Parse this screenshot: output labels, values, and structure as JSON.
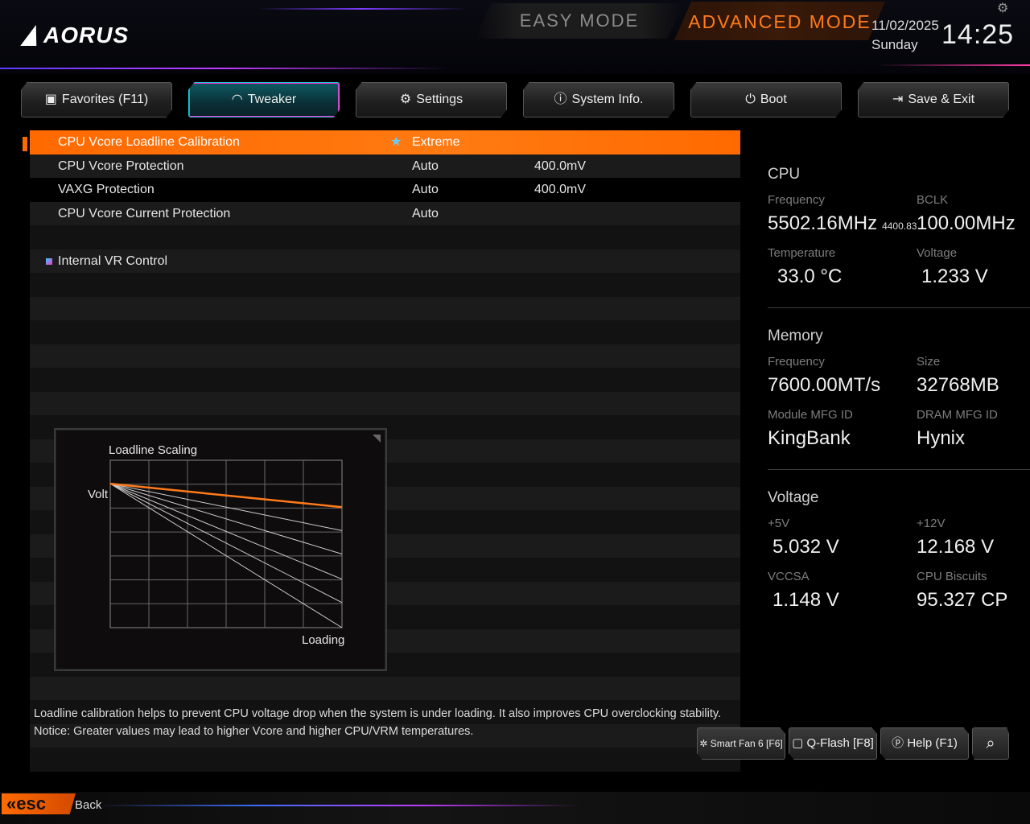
{
  "brand": {
    "logo_text": "AORUS"
  },
  "modes": {
    "easy": "EASY MODE",
    "advanced": "ADVANCED MODE"
  },
  "clock": {
    "date": "11/02/2025",
    "weekday": "Sunday",
    "time": "14:25"
  },
  "tabs": [
    {
      "label": "Favorites (F11)",
      "icon": "favorites-icon"
    },
    {
      "label": "Tweaker",
      "icon": "speedometer-icon",
      "active": true
    },
    {
      "label": "Settings",
      "icon": "gear-icon"
    },
    {
      "label": "System Info.",
      "icon": "info-icon"
    },
    {
      "label": "Boot",
      "icon": "power-icon"
    },
    {
      "label": "Save & Exit",
      "icon": "exit-icon"
    }
  ],
  "settings": [
    {
      "label": "CPU Vcore Loadline Calibration",
      "value": "Extreme",
      "selected": true
    },
    {
      "label": "CPU Vcore Protection",
      "value": "Auto",
      "value2": "400.0mV"
    },
    {
      "label": "VAXG Protection",
      "value": "Auto",
      "value2": "400.0mV"
    },
    {
      "label": "CPU Vcore Current Protection",
      "value": "Auto"
    },
    {
      "label": ""
    },
    {
      "label": "Internal VR Control",
      "submenu": true
    }
  ],
  "chart": {
    "title": "Loadline Scaling",
    "ylabel": "Volt",
    "xlabel": "Loading",
    "selected_color": "#ff7a1a",
    "line_color": "#cfcfcf"
  },
  "chart_data": {
    "type": "line",
    "title": "Loadline Scaling",
    "xlabel": "Loading",
    "ylabel": "Volt",
    "x": [
      0,
      1
    ],
    "xlim": [
      0,
      1
    ],
    "ylim": [
      0,
      1
    ],
    "grid": true,
    "series": [
      {
        "values": [
          0.86,
          0.72
        ],
        "highlight": true
      },
      {
        "values": [
          0.86,
          0.58
        ]
      },
      {
        "values": [
          0.86,
          0.44
        ]
      },
      {
        "values": [
          0.86,
          0.29
        ]
      },
      {
        "values": [
          0.86,
          0.15
        ]
      },
      {
        "values": [
          0.86,
          0.0
        ]
      }
    ]
  },
  "info": {
    "cpu": {
      "title": "CPU",
      "frequency_label": "Frequency",
      "frequency": "5502.16MHz",
      "frequency_sub": "4400.83",
      "bclk_label": "BCLK",
      "bclk": "100.00MHz",
      "temp_label": "Temperature",
      "temp": "33.0 °C",
      "voltage_label": "Voltage",
      "voltage": "1.233 V"
    },
    "memory": {
      "title": "Memory",
      "frequency_label": "Frequency",
      "frequency": "7600.00MT/s",
      "size_label": "Size",
      "size": "32768MB",
      "module_label": "Module MFG ID",
      "module": "KingBank",
      "dram_label": "DRAM MFG ID",
      "dram": "Hynix"
    },
    "voltage": {
      "title": "Voltage",
      "v5_label": "+5V",
      "v5": "5.032 V",
      "v12_label": "+12V",
      "v12": "12.168 V",
      "vccsa_label": "VCCSA",
      "vccsa": "1.148 V",
      "biscuits_label": "CPU Biscuits",
      "biscuits": "95.327 CP"
    }
  },
  "help": {
    "line1": "Loadline calibration helps to prevent CPU voltage drop when the system is under loading. It also improves CPU overclocking stability.",
    "line2": "Notice: Greater values may lead to higher Vcore and higher CPU/VRM temperatures."
  },
  "bottom_buttons": [
    {
      "label": "Smart Fan 6 [F6]",
      "icon": "fan-icon"
    },
    {
      "label": "Q-Flash [F8]",
      "icon": "chip-icon"
    },
    {
      "label": "Help (F1)",
      "icon": "help-icon"
    }
  ],
  "esc": {
    "key": "esc",
    "label": "Back"
  },
  "colors": {
    "accent": "#ff6a00",
    "tab_active": "#1fc8d8",
    "tab_active_edge": "#ff2fd0"
  }
}
